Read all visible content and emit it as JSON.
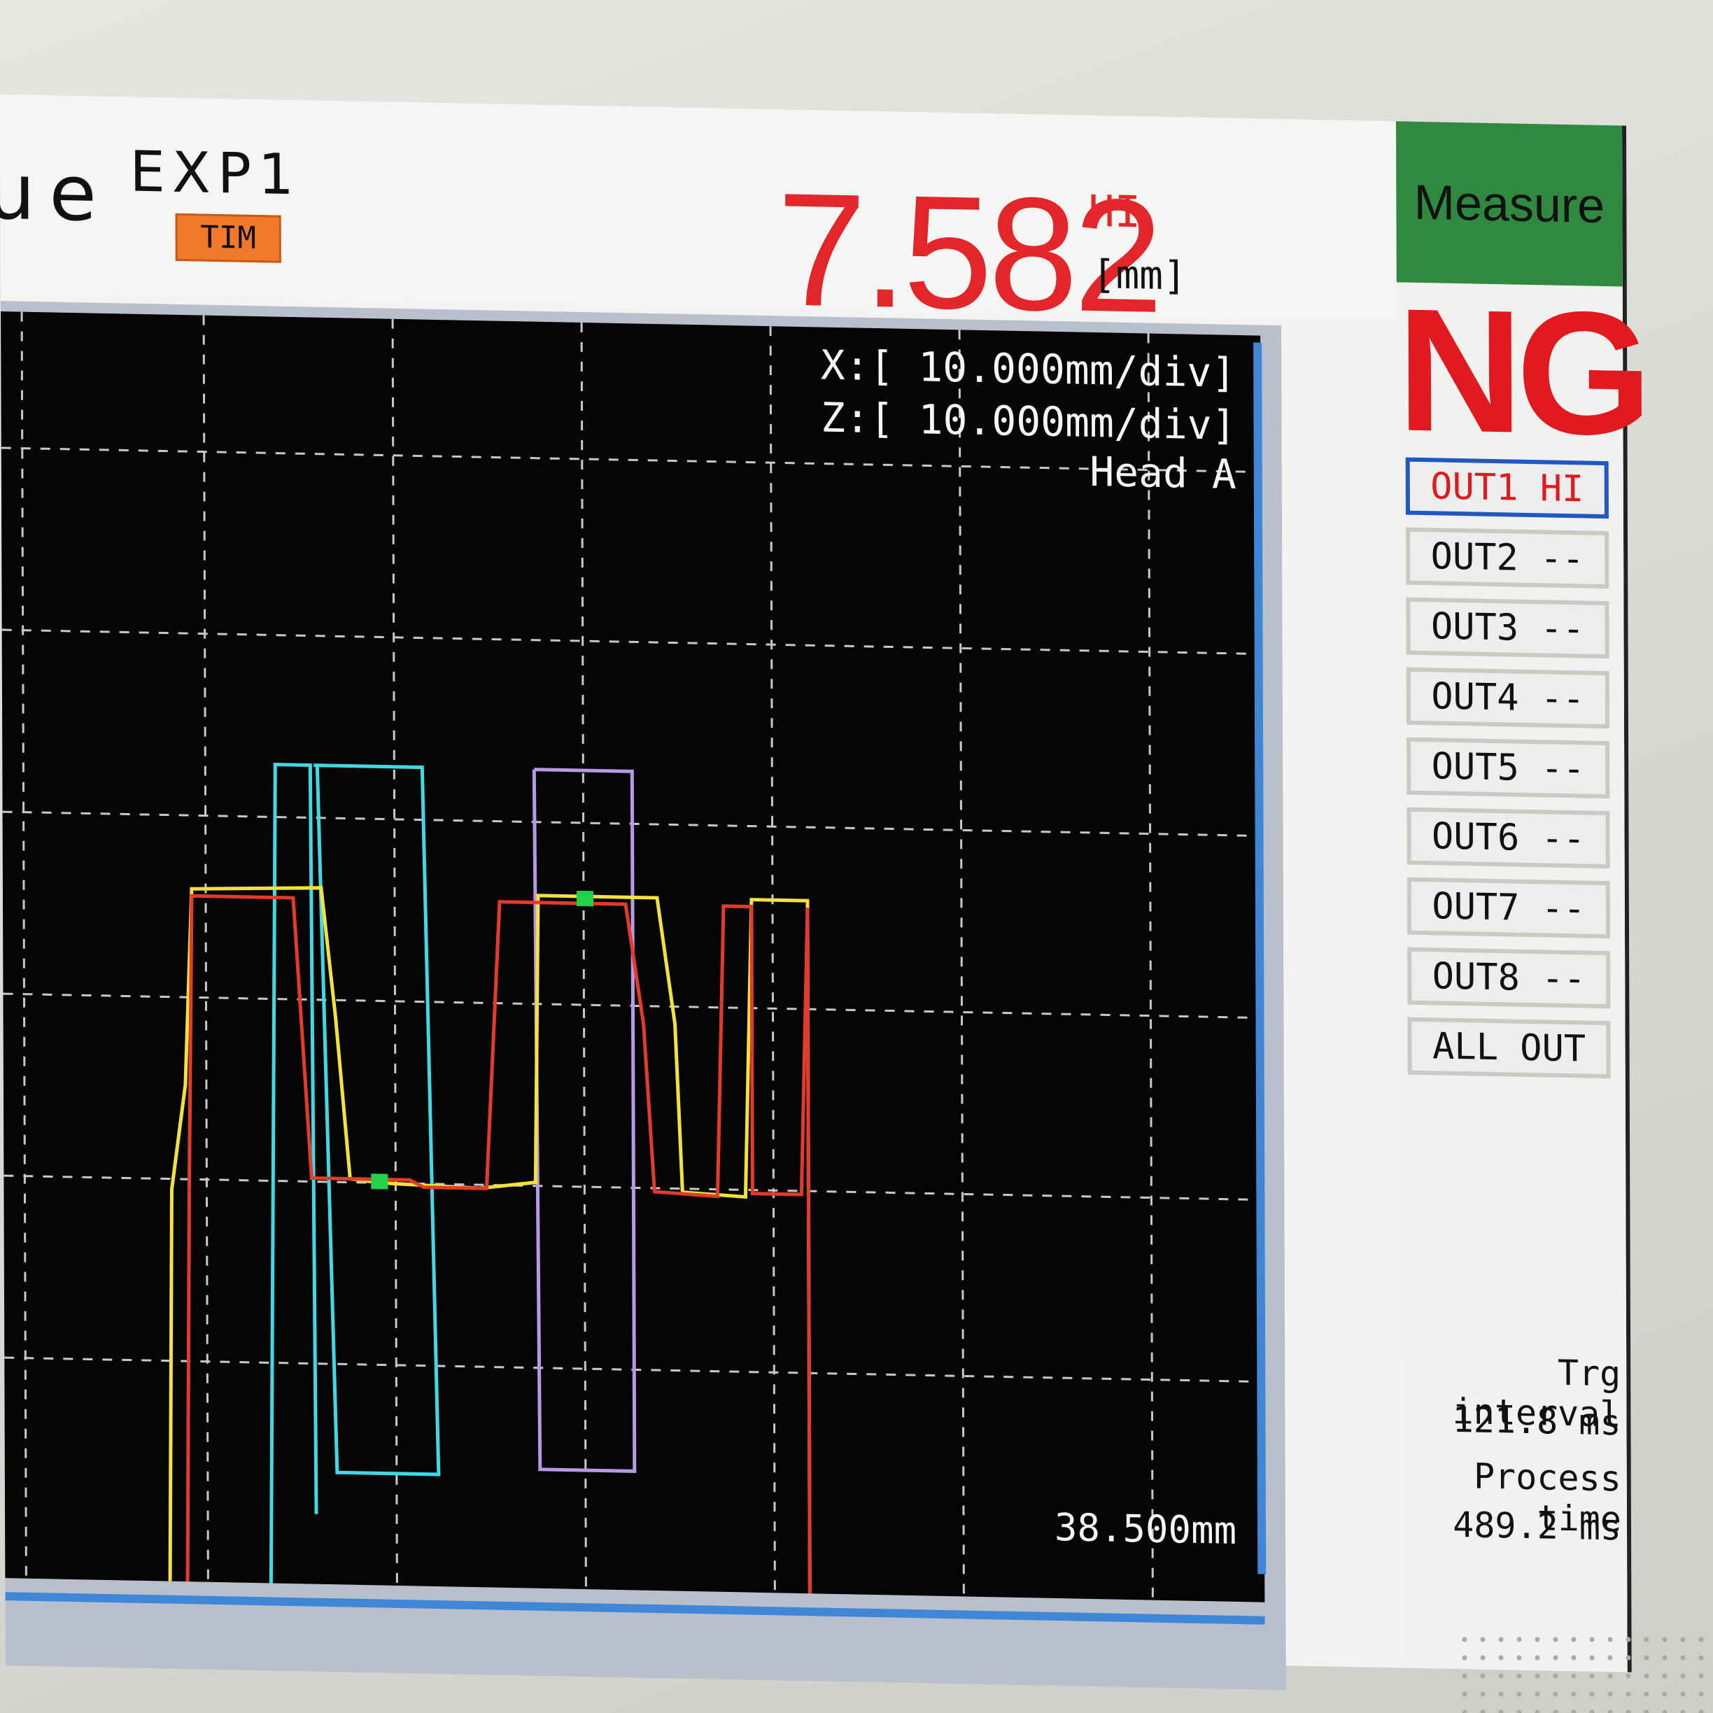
{
  "header": {
    "mode_text": "ue",
    "exp_label": "EXP1",
    "tim_badge": "TIM",
    "measurement": {
      "value": "7.582",
      "judgement": "HI",
      "unit": "[mm]"
    }
  },
  "graph": {
    "x_scale": "X:[ 10.000mm/div]",
    "z_scale": "Z:[ 10.000mm/div]",
    "head": "Head A",
    "position_readout": "38.500mm"
  },
  "panel": {
    "measure_tab": "Measure",
    "result": "NG",
    "outputs": [
      {
        "label": "OUT1 HI",
        "active": true
      },
      {
        "label": "OUT2 --",
        "active": false
      },
      {
        "label": "OUT3 --",
        "active": false
      },
      {
        "label": "OUT4 --",
        "active": false
      },
      {
        "label": "OUT5 --",
        "active": false
      },
      {
        "label": "OUT6 --",
        "active": false
      },
      {
        "label": "OUT7 --",
        "active": false
      },
      {
        "label": "OUT8 --",
        "active": false
      },
      {
        "label": "ALL OUT",
        "active": false
      }
    ],
    "trg_interval_label": "Trg interval",
    "trg_interval_value": "121.8 ms",
    "process_time_label": "Process time",
    "process_time_value": "489.2 ms"
  },
  "colors": {
    "value_red": "#e3262a",
    "measure_green": "#2f8a3f",
    "tim_orange": "#f07a2a",
    "trace_yellow": "#f2e23a",
    "trace_red": "#e33a2c",
    "trace_cyan": "#3fd9e6",
    "trace_violet": "#b69ae6",
    "marker_green": "#22d24a"
  }
}
